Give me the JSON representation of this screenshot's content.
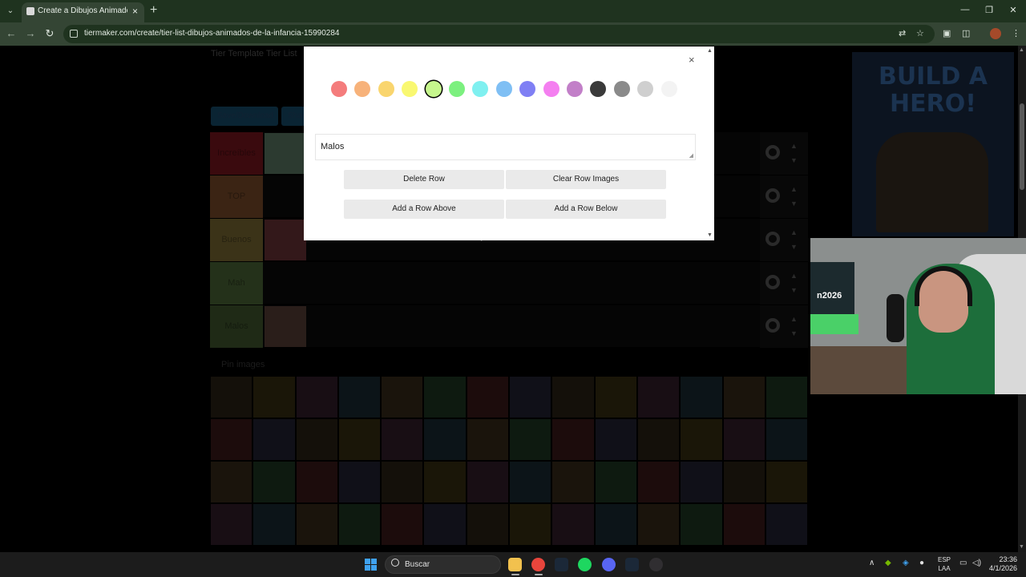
{
  "browser": {
    "tab_title": "Create a Dibujos Animados de la Infancia Tier List",
    "url": "tiermaker.com/create/tier-list-dibujos-animados-de-la-infancia-15990284",
    "new_tab": "+",
    "close_tab": "×",
    "window_controls": {
      "minimize": "—",
      "restore": "❐",
      "close": "✕"
    }
  },
  "page": {
    "title_dim": "Tier Template Tier List",
    "buttons_dim": [
      "Save/Download",
      "Share"
    ],
    "tiers": [
      {
        "label": "Increíbles",
        "color": "#3a0a0e"
      },
      {
        "label": "TOP",
        "color": "#3b2414"
      },
      {
        "label": "Buenos",
        "color": "#3b3318"
      },
      {
        "label": "Mah",
        "color": "#24311a"
      },
      {
        "label": "Malos",
        "color": "#1f2a16"
      }
    ],
    "pool_label": "Pin images",
    "ad_text": "BUILD A HERO!"
  },
  "modal": {
    "close": "×",
    "colors": [
      "#f47c7c",
      "#f7b27a",
      "#f9d56e",
      "#f9f871",
      "#c6f68d",
      "#7cf07f",
      "#7ff0f0",
      "#7fbff4",
      "#7f7ff4",
      "#f47ff0",
      "#c27fc8",
      "#3a3a3a",
      "#8a8a8a",
      "#cfcfcf",
      "#f3f3f3"
    ],
    "selected_color_index": 4,
    "row_name_value": "Malos",
    "delete_row": "Delete Row",
    "clear_row_images": "Clear Row Images",
    "add_row_above": "Add a Row Above",
    "add_row_below": "Add a Row Below"
  },
  "webcam": {
    "overlay_text": "n2026"
  },
  "taskbar": {
    "search_placeholder": "Buscar",
    "lang_line1": "ESP",
    "lang_line2": "LAA",
    "time": "23:36",
    "date": "4/1/2026",
    "apps": [
      {
        "name": "file-explorer",
        "color": "#f2c14e"
      },
      {
        "name": "chrome",
        "color": "#e8453c"
      },
      {
        "name": "steam",
        "color": "#1b2838"
      },
      {
        "name": "spotify",
        "color": "#1ed760"
      },
      {
        "name": "discord",
        "color": "#5865f2"
      },
      {
        "name": "steam-2",
        "color": "#1b2838"
      },
      {
        "name": "obs",
        "color": "#302e31"
      }
    ]
  }
}
